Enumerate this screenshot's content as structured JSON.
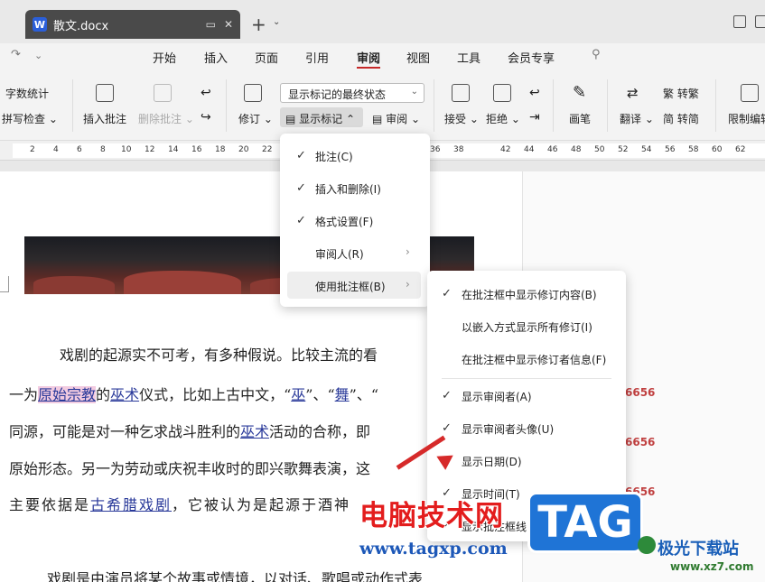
{
  "titlebar": {
    "doc_title": "散文.docx",
    "app_badge": "W"
  },
  "menubar": {
    "items": [
      "开始",
      "插入",
      "页面",
      "引用",
      "审阅",
      "视图",
      "工具",
      "会员专享"
    ],
    "active": "审阅"
  },
  "ribbon": {
    "word_count": "字数统计",
    "spell_check": "拼写检查",
    "insert_comment": "插入批注",
    "delete_comment": "删除批注",
    "track": "修订",
    "markup_state": "显示标记的最终状态",
    "show_markup": "显示标记",
    "review": "审阅",
    "accept": "接受",
    "reject": "拒绝",
    "pen": "画笔",
    "translate": "翻译",
    "to_traditional": "转繁",
    "to_simplified": "转简",
    "restrict_edit": "限制编辑"
  },
  "ruler": {
    "left_ticks": [
      "2",
      "4",
      "6",
      "8",
      "10",
      "12",
      "14",
      "16",
      "18",
      "20",
      "22"
    ],
    "right_ticks": [
      "36",
      "38",
      "42",
      "44",
      "46",
      "48",
      "50",
      "52",
      "54",
      "56",
      "58",
      "60",
      "62"
    ]
  },
  "menu_show_markup": {
    "items": [
      {
        "label": "批注(C)",
        "checked": true
      },
      {
        "label": "插入和删除(I)",
        "checked": true
      },
      {
        "label": "格式设置(F)",
        "checked": true
      },
      {
        "label": "审阅人(R)",
        "checked": false
      },
      {
        "label": "使用批注框(B)",
        "checked": false
      }
    ]
  },
  "menu_balloons": {
    "items": [
      {
        "label": "在批注框中显示修订内容(B)",
        "checked": true
      },
      {
        "label": "以嵌入方式显示所有修订(I)",
        "checked": false
      },
      {
        "label": "在批注框中显示修订者信息(F)",
        "checked": false
      },
      {
        "label": "显示审阅者(A)",
        "checked": true
      },
      {
        "label": "显示审阅者头像(U)",
        "checked": true
      },
      {
        "label": "显示日期(D)",
        "checked": false
      },
      {
        "label": "显示时间(T)",
        "checked": true
      },
      {
        "label": "显示批注框线",
        "checked": true
      }
    ]
  },
  "document": {
    "para1": {
      "line1": "戏剧的起源实不可考，有多种假说。比较主流的看",
      "line2_a": "一为",
      "line2_hl": "原始宗教",
      "line2_b": "的",
      "line2_ins1": "巫术",
      "line2_c": "仪式，比如上古中文，“",
      "line2_ins2": "巫",
      "line2_d": "”、“",
      "line2_ins3": "舞",
      "line2_e": "”、“",
      "line3_a": "同源，可能是对一种乞求战斗胜利的",
      "line3_ins": "巫术",
      "line3_b": "活动的合称，即",
      "line4": "原始形态。另一为劳动或庆祝丰收时的即兴歌舞表演，这",
      "line5_a": "主要依据是",
      "line5_ins": "古希腊戏剧",
      "line5_b": "，它被认为是起源于酒神"
    },
    "para2": "戏剧是由演员将某个故事或情境，以对话、歌唱或动作式表",
    "markup_numbers": [
      "6656",
      "6656",
      "6656"
    ]
  },
  "watermark": {
    "cn_title": "电脑技术网",
    "url": "www.tagxp.com",
    "badge": "TAG",
    "site2": "极光下载站",
    "site2_url": "www.xz7.com"
  },
  "colors": {
    "accent_red": "#c62828",
    "insert_blue": "#2a3a9a",
    "highlight_pink": "#f2cbe0",
    "markup_red": "#c04040"
  }
}
